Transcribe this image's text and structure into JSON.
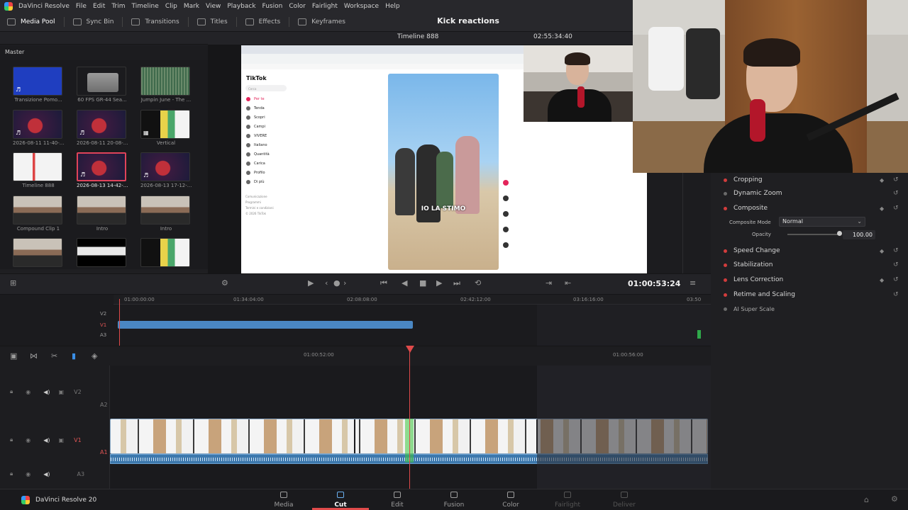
{
  "menu": [
    "DaVinci Resolve",
    "File",
    "Edit",
    "Trim",
    "Timeline",
    "Clip",
    "Mark",
    "View",
    "Playback",
    "Fusion",
    "Color",
    "Fairlight",
    "Workspace",
    "Help"
  ],
  "toolbar": {
    "media_pool": "Media Pool",
    "sync_bin": "Sync Bin",
    "transitions": "Transitions",
    "titles": "Titles",
    "effects": "Effects",
    "keyframes": "Keyframes"
  },
  "project_title": "Kick reactions",
  "viewer": {
    "timeline_name": "Timeline 888",
    "source_timecode": "02:55:34:40"
  },
  "media_pool": {
    "bin": "Master",
    "clips": [
      {
        "name": "Transizione Pomo..."
      },
      {
        "name": "60 FPS GR-44 Sea..."
      },
      {
        "name": "Jumpin June - The ..."
      },
      {
        "name": "2026-08-11 11-40-..."
      },
      {
        "name": "2026-08-11 20-08-..."
      },
      {
        "name": "Vertical"
      },
      {
        "name": "Timeline 888"
      },
      {
        "name": "2026-08-13 14-42-..."
      },
      {
        "name": "2026-08-13 17-12-..."
      },
      {
        "name": "Compound Clip 1"
      },
      {
        "name": "Intro"
      },
      {
        "name": "Intro"
      },
      {
        "name": ""
      },
      {
        "name": ""
      },
      {
        "name": ""
      }
    ]
  },
  "tiktok": {
    "logo": "TikTok",
    "search": "Cerca",
    "menu": [
      "Per te",
      "Tenda",
      "Scopri",
      "Campi",
      "VIVERE",
      "Italiano",
      "Quantità",
      "Carica",
      "Profilo",
      "Di più"
    ],
    "caption": "IO LA STIMO",
    "footer": [
      "Comunicazione",
      "Programmi",
      "Termini e condizioni",
      "© 2026 TikTok"
    ]
  },
  "inspector": {
    "items": [
      {
        "label": "Cropping"
      },
      {
        "label": "Dynamic Zoom"
      },
      {
        "label": "Composite"
      },
      {
        "label": "Speed Change"
      },
      {
        "label": "Stabilization"
      },
      {
        "label": "Lens Correction"
      },
      {
        "label": "Retime and Scaling"
      },
      {
        "label": "AI Super Scale"
      }
    ],
    "composite_mode_label": "Composite Mode",
    "composite_mode_value": "Normal",
    "opacity_label": "Opacity",
    "opacity_value": "100.00"
  },
  "transport": {
    "timecode": "01:00:53:24"
  },
  "upper_timeline": {
    "ruler": [
      "01:00:00:00",
      "01:34:04:00",
      "02:08:08:00",
      "02:42:12:00",
      "03:16:16:00",
      "03:50"
    ],
    "tracks": [
      "V2",
      "V1",
      "A3"
    ]
  },
  "lower_timeline": {
    "ruler": [
      "01:00:52:00",
      "01:00:56:00"
    ],
    "tracks": [
      "V2",
      "A2",
      "V1",
      "A1",
      "A3"
    ]
  },
  "bottom": {
    "brand": "DaVinci Resolve 20",
    "pages": [
      "Media",
      "Cut",
      "Edit",
      "Fusion",
      "Color",
      "Fairlight",
      "Deliver"
    ]
  },
  "icons": {
    "home": "home-icon",
    "gear": "gear-icon"
  },
  "colors": {
    "playhead": "#e04a4a",
    "clip_blue": "#4a87c3",
    "accent_led": "#d23c3c"
  }
}
